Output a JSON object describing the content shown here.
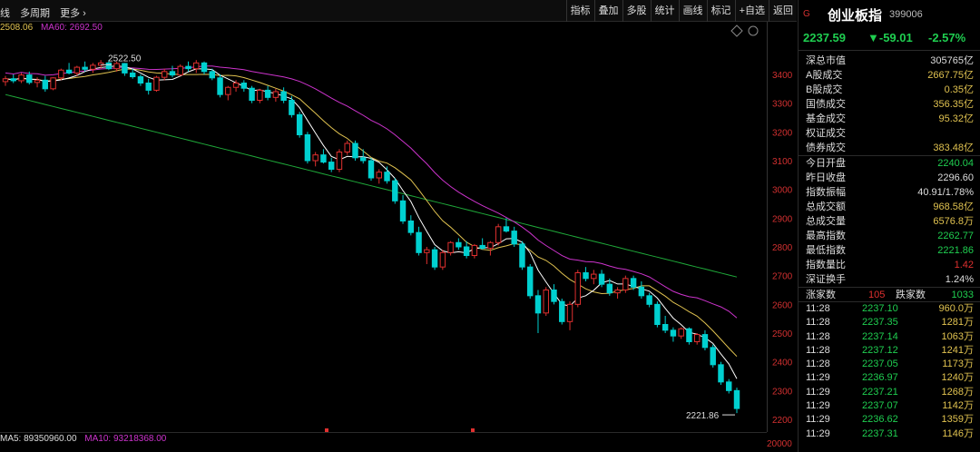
{
  "toolbar": {
    "left_items": [
      "线",
      "多周期",
      "更多 ›"
    ],
    "right_items": [
      "指标",
      "叠加",
      "多股",
      "统计",
      "画线",
      "标记",
      "+自选",
      "返回"
    ]
  },
  "ma_legend": {
    "current": "2508.06",
    "ma60": "MA60: 2692.50"
  },
  "chart_data": {
    "type": "candlestick",
    "y_ticks": [
      "3400",
      "3300",
      "3200",
      "3100",
      "3000",
      "2900",
      "2800",
      "2700",
      "2600",
      "2500",
      "2400",
      "2300",
      "2200"
    ],
    "high_label": "2522.50",
    "low_label": "2221.86",
    "ohlc": [
      [
        3375,
        3395,
        3360,
        3385
      ],
      [
        3385,
        3400,
        3370,
        3378
      ],
      [
        3378,
        3405,
        3370,
        3398
      ],
      [
        3398,
        3410,
        3365,
        3372
      ],
      [
        3372,
        3390,
        3355,
        3380
      ],
      [
        3380,
        3395,
        3340,
        3350
      ],
      [
        3350,
        3390,
        3345,
        3388
      ],
      [
        3388,
        3420,
        3380,
        3415
      ],
      [
        3415,
        3440,
        3400,
        3405
      ],
      [
        3405,
        3430,
        3395,
        3425
      ],
      [
        3425,
        3445,
        3410,
        3418
      ],
      [
        3418,
        3440,
        3405,
        3432
      ],
      [
        3432,
        3450,
        3420,
        3440
      ],
      [
        3440,
        3450,
        3415,
        3420
      ],
      [
        3420,
        3445,
        3410,
        3438
      ],
      [
        3438,
        3440,
        3395,
        3405
      ],
      [
        3405,
        3420,
        3385,
        3392
      ],
      [
        3392,
        3400,
        3360,
        3370
      ],
      [
        3370,
        3385,
        3330,
        3345
      ],
      [
        3345,
        3395,
        3340,
        3390
      ],
      [
        3390,
        3420,
        3380,
        3410
      ],
      [
        3410,
        3430,
        3390,
        3398
      ],
      [
        3398,
        3435,
        3395,
        3428
      ],
      [
        3428,
        3445,
        3410,
        3420
      ],
      [
        3420,
        3450,
        3405,
        3440
      ],
      [
        3440,
        3445,
        3400,
        3410
      ],
      [
        3410,
        3420,
        3380,
        3388
      ],
      [
        3388,
        3400,
        3320,
        3330
      ],
      [
        3330,
        3360,
        3310,
        3355
      ],
      [
        3355,
        3380,
        3340,
        3370
      ],
      [
        3370,
        3380,
        3340,
        3352
      ],
      [
        3352,
        3360,
        3300,
        3310
      ],
      [
        3310,
        3350,
        3300,
        3345
      ],
      [
        3345,
        3360,
        3310,
        3320
      ],
      [
        3320,
        3350,
        3305,
        3340
      ],
      [
        3340,
        3355,
        3300,
        3310
      ],
      [
        3310,
        3325,
        3250,
        3260
      ],
      [
        3260,
        3270,
        3180,
        3190
      ],
      [
        3190,
        3200,
        3090,
        3100
      ],
      [
        3100,
        3130,
        3080,
        3120
      ],
      [
        3120,
        3140,
        3090,
        3095
      ],
      [
        3095,
        3110,
        3060,
        3070
      ],
      [
        3070,
        3140,
        3060,
        3130
      ],
      [
        3130,
        3170,
        3120,
        3160
      ],
      [
        3160,
        3170,
        3100,
        3110
      ],
      [
        3110,
        3140,
        3090,
        3100
      ],
      [
        3100,
        3110,
        3030,
        3040
      ],
      [
        3040,
        3070,
        3020,
        3060
      ],
      [
        3060,
        3080,
        3020,
        3030
      ],
      [
        3030,
        3040,
        2950,
        2960
      ],
      [
        2960,
        2980,
        2880,
        2890
      ],
      [
        2890,
        2910,
        2840,
        2850
      ],
      [
        2850,
        2870,
        2770,
        2780
      ],
      [
        2780,
        2800,
        2740,
        2790
      ],
      [
        2790,
        2800,
        2720,
        2730
      ],
      [
        2730,
        2790,
        2720,
        2780
      ],
      [
        2780,
        2820,
        2770,
        2815
      ],
      [
        2815,
        2830,
        2790,
        2800
      ],
      [
        2800,
        2820,
        2760,
        2770
      ],
      [
        2770,
        2810,
        2760,
        2805
      ],
      [
        2805,
        2830,
        2790,
        2795
      ],
      [
        2795,
        2820,
        2770,
        2815
      ],
      [
        2815,
        2880,
        2805,
        2870
      ],
      [
        2870,
        2900,
        2850,
        2855
      ],
      [
        2855,
        2870,
        2800,
        2810
      ],
      [
        2810,
        2820,
        2720,
        2730
      ],
      [
        2730,
        2740,
        2620,
        2630
      ],
      [
        2630,
        2650,
        2500,
        2570
      ],
      [
        2570,
        2660,
        2560,
        2650
      ],
      [
        2650,
        2670,
        2600,
        2610
      ],
      [
        2610,
        2620,
        2530,
        2540
      ],
      [
        2540,
        2610,
        2510,
        2600
      ],
      [
        2600,
        2720,
        2590,
        2710
      ],
      [
        2710,
        2730,
        2680,
        2690
      ],
      [
        2690,
        2720,
        2670,
        2705
      ],
      [
        2705,
        2720,
        2660,
        2670
      ],
      [
        2670,
        2690,
        2630,
        2640
      ],
      [
        2640,
        2660,
        2620,
        2650
      ],
      [
        2650,
        2700,
        2640,
        2690
      ],
      [
        2690,
        2700,
        2650,
        2660
      ],
      [
        2660,
        2680,
        2620,
        2630
      ],
      [
        2630,
        2640,
        2590,
        2600
      ],
      [
        2600,
        2610,
        2520,
        2530
      ],
      [
        2530,
        2560,
        2500,
        2510
      ],
      [
        2510,
        2520,
        2470,
        2490
      ],
      [
        2490,
        2520,
        2480,
        2515
      ],
      [
        2515,
        2520,
        2460,
        2470
      ],
      [
        2470,
        2500,
        2460,
        2495
      ],
      [
        2495,
        2510,
        2440,
        2450
      ],
      [
        2450,
        2460,
        2380,
        2390
      ],
      [
        2390,
        2400,
        2320,
        2330
      ],
      [
        2330,
        2340,
        2290,
        2300
      ],
      [
        2300,
        2310,
        2221.86,
        2237.59
      ]
    ]
  },
  "volume_legend": {
    "ma5": "MA5: 89350960.00",
    "ma10": "MA10: 93218368.00",
    "axis_label": "20000"
  },
  "panel": {
    "marker": "G",
    "name": "创业板指",
    "code": "399006",
    "price": "2237.59",
    "change": "▼-59.01",
    "pct": "-2.57%",
    "stats1": [
      {
        "k": "深总市值",
        "v": "305765亿",
        "c": ""
      },
      {
        "k": "A股成交",
        "v": "2667.75亿",
        "c": "yellow"
      },
      {
        "k": "B股成交",
        "v": "0.35亿",
        "c": "yellow"
      },
      {
        "k": "国债成交",
        "v": "356.35亿",
        "c": "yellow"
      },
      {
        "k": "基金成交",
        "v": "95.32亿",
        "c": "yellow"
      },
      {
        "k": "权证成交",
        "v": "",
        "c": ""
      },
      {
        "k": "债券成交",
        "v": "383.48亿",
        "c": "yellow"
      }
    ],
    "stats2": [
      {
        "k": "今日开盘",
        "v": "2240.04",
        "c": "green"
      },
      {
        "k": "昨日收盘",
        "v": "2296.60",
        "c": ""
      },
      {
        "k": "指数振幅",
        "v": "40.91/1.78%",
        "c": ""
      },
      {
        "k": "总成交额",
        "v": "968.58亿",
        "c": "yellow"
      },
      {
        "k": "总成交量",
        "v": "6576.8万",
        "c": "yellow"
      },
      {
        "k": "最高指数",
        "v": "2262.77",
        "c": "green"
      },
      {
        "k": "最低指数",
        "v": "2221.86",
        "c": "green"
      },
      {
        "k": "指数量比",
        "v": "1.42",
        "c": "red"
      },
      {
        "k": "深证换手",
        "v": "1.24%",
        "c": ""
      }
    ],
    "up_label": "涨家数",
    "up_count": "105",
    "down_label": "跌家数",
    "down_count": "1033",
    "ticks": [
      {
        "t": "11:28",
        "p": "2237.10",
        "q": "960.0万"
      },
      {
        "t": "11:28",
        "p": "2237.35",
        "q": "1281万"
      },
      {
        "t": "11:28",
        "p": "2237.14",
        "q": "1063万"
      },
      {
        "t": "11:28",
        "p": "2237.12",
        "q": "1241万"
      },
      {
        "t": "11:28",
        "p": "2237.05",
        "q": "1173万"
      },
      {
        "t": "11:29",
        "p": "2236.97",
        "q": "1240万"
      },
      {
        "t": "11:29",
        "p": "2237.21",
        "q": "1268万"
      },
      {
        "t": "11:29",
        "p": "2237.07",
        "q": "1142万"
      },
      {
        "t": "11:29",
        "p": "2236.62",
        "q": "1359万"
      },
      {
        "t": "11:29",
        "p": "2237.31",
        "q": "1146万"
      }
    ]
  },
  "colors": {
    "up": "#e0302f",
    "down": "#00d0d0",
    "ma5": "#ffffff",
    "ma10": "#e0c250",
    "ma20": "#cc33cc",
    "ma60": "#1faa3a"
  }
}
